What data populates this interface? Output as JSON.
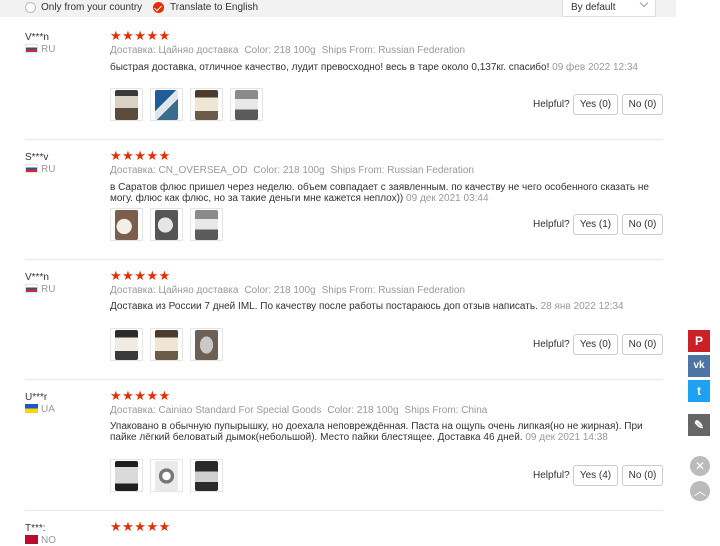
{
  "filters": {
    "only_country": "Only from your country",
    "translate": "Translate to English",
    "sort": "By default"
  },
  "reviews": [
    {
      "user": "V***n",
      "country": "RU",
      "stars": "★★★★★",
      "shipping": "Доставка: Цайняо доставка",
      "color": "Color: 218 100g",
      "ships_from": "Ships From: Russian Federation",
      "text": "быстрая доставка, отличное качество, лудит превосходно! весь в таре около 0,137кг. спасибо!",
      "date": "09 фев 2022 12:34",
      "helpful_label": "Helpful?",
      "yes": "Yes (0)",
      "no": "No (0)"
    },
    {
      "user": "S***v",
      "country": "RU",
      "stars": "★★★★★",
      "shipping": "Доставка: CN_OVERSEA_OD",
      "color": "Color: 218 100g",
      "ships_from": "Ships From: Russian Federation",
      "text": "в Саратов флюс пришел через неделю. объем совпадает с заявленным. по качеству не чего особенного сказать не могу. флюс как флюс, но за такие деньги мне кажется неплох))",
      "date": "09 дек 2021 03:44",
      "helpful_label": "Helpful?",
      "yes": "Yes (1)",
      "no": "No (0)"
    },
    {
      "user": "V***n",
      "country": "RU",
      "stars": "★★★★★",
      "shipping": "Доставка: Цайняо доставка",
      "color": "Color: 218 100g",
      "ships_from": "Ships From: Russian Federation",
      "text": "Доставка из России 7 дней IML. По качеству после работы постараюсь доп отзыв написать.",
      "date": "28 янв 2022 12:34",
      "helpful_label": "Helpful?",
      "yes": "Yes (0)",
      "no": "No (0)"
    },
    {
      "user": "U***r",
      "country": "UA",
      "stars": "★★★★★",
      "shipping": "Доставка: Cainiao Standard For Special Goods",
      "color": "Color: 218 100g",
      "ships_from": "Ships From: China",
      "text": "Упаковано в обычную пупырышку, но доехала неповреждённая. Паста на ощупь очень липкая(но не жирная). При пайке лёгкий беловатый дымок(небольшой). Место пайки блестящее. Доставка 46 дней.",
      "date": "09 дек 2021 14:38",
      "helpful_label": "Helpful?",
      "yes": "Yes (4)",
      "no": "No (0)"
    },
    {
      "user": "T***:",
      "country": "NO",
      "stars": "★★★★★"
    }
  ],
  "social": [
    "pinterest-icon",
    "vk-icon",
    "twitter-icon",
    "edit-icon",
    "close-icon",
    "scroll-top-icon"
  ]
}
